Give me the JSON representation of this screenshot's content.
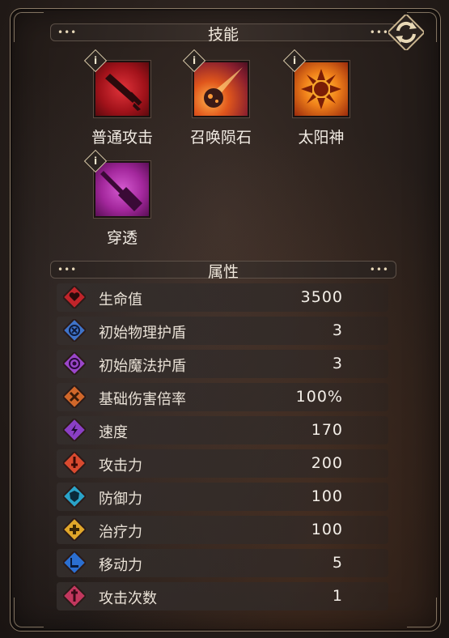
{
  "skills_section": {
    "title": "技能",
    "skills": [
      {
        "label": "普通攻击",
        "icon": "sword-icon",
        "info": "i"
      },
      {
        "label": "召唤陨石",
        "icon": "meteor-icon",
        "info": "i"
      },
      {
        "label": "太阳神",
        "icon": "sun-icon",
        "info": "i"
      },
      {
        "label": "穿透",
        "icon": "pierce-icon",
        "info": "i"
      }
    ]
  },
  "attributes_section": {
    "title": "属性",
    "rows": [
      {
        "name": "生命值",
        "value": "3500",
        "icon": "heart-icon",
        "color": "#c0242a"
      },
      {
        "name": "初始物理护盾",
        "value": "3",
        "icon": "physical-shield-icon",
        "color": "#3f73c8"
      },
      {
        "name": "初始魔法护盾",
        "value": "3",
        "icon": "magic-shield-icon",
        "color": "#9a46c9"
      },
      {
        "name": "基础伤害倍率",
        "value": "100%",
        "icon": "damage-multiplier-icon",
        "color": "#d0672a"
      },
      {
        "name": "速度",
        "value": "170",
        "icon": "speed-icon",
        "color": "#8a3fc4"
      },
      {
        "name": "攻击力",
        "value": "200",
        "icon": "attack-icon",
        "color": "#d94a2f"
      },
      {
        "name": "防御力",
        "value": "100",
        "icon": "defense-icon",
        "color": "#2aa3c8"
      },
      {
        "name": "治疗力",
        "value": "100",
        "icon": "heal-icon",
        "color": "#e0a62a"
      },
      {
        "name": "移动力",
        "value": "5",
        "icon": "move-icon",
        "color": "#2b6fd1"
      },
      {
        "name": "攻击次数",
        "value": "1",
        "icon": "attack-count-icon",
        "color": "#c2375e"
      }
    ]
  },
  "ui": {
    "dots": "•••",
    "swap_icon": "swap-icon"
  }
}
